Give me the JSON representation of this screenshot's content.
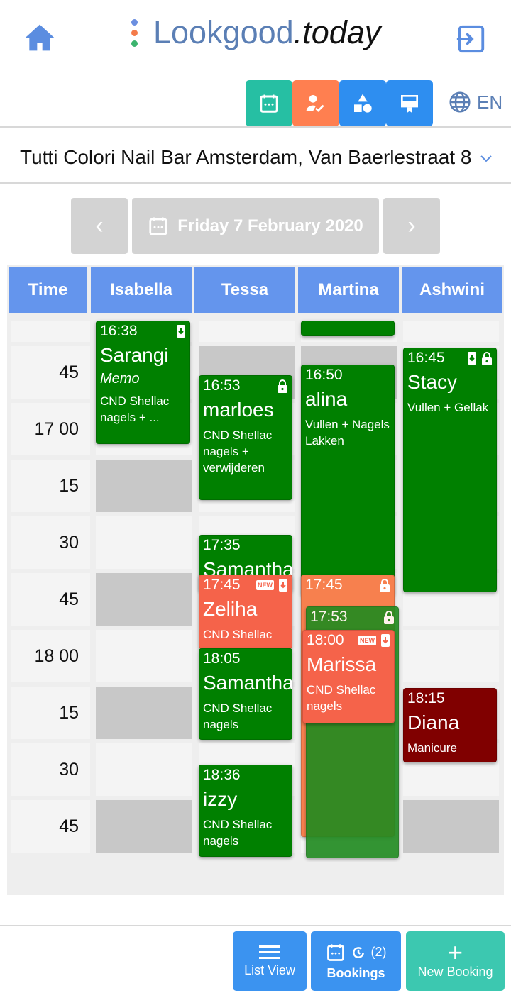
{
  "header": {
    "logo_main": "Lookgood",
    "logo_suffix": ".today",
    "language": "EN"
  },
  "toolbar": {
    "colors": {
      "calendar": "#26bfa3",
      "customers": "#ff7f50",
      "services": "#2e8ef0",
      "vouchers": "#2e8ef0"
    }
  },
  "salon": {
    "selected": "Tutti Colori Nail Bar Amsterdam, Van Baerlestraat 8"
  },
  "date_nav": {
    "date": "Friday 7 February 2020",
    "prev": "‹",
    "next": "›"
  },
  "columns": [
    "Time",
    "Isabella",
    "Tessa",
    "Martina",
    "Ashwini"
  ],
  "time_labels": [
    "45",
    "17 00",
    "15",
    "30",
    "45",
    "18 00",
    "15",
    "30",
    "45"
  ],
  "events": [
    {
      "staff": "Isabella",
      "time": "16:38",
      "name": "Sarangi",
      "memo": "Memo",
      "service": "CND Shellac nagels + ...",
      "color": "#008000",
      "icons": [
        "download"
      ]
    },
    {
      "staff": "Martina",
      "time": "",
      "name": "",
      "service": "",
      "color": "#008000",
      "icons": []
    },
    {
      "staff": "Tessa",
      "time": "16:53",
      "name": "marloes",
      "service": "CND Shellac nagels + verwijderen",
      "color": "#008000",
      "icons": [
        "lock"
      ]
    },
    {
      "staff": "Martina",
      "time": "16:50",
      "name": "alina",
      "service": "Vullen + Nagels Lakken",
      "color": "#008000",
      "icons": []
    },
    {
      "staff": "Ashwini",
      "time": "16:45",
      "name": "Stacy",
      "service": "Vullen + Gellak",
      "color": "#008000",
      "icons": [
        "download",
        "lock"
      ]
    },
    {
      "staff": "Tessa",
      "time": "17:35",
      "name": "Samantha",
      "service": "",
      "color": "#008000",
      "icons": []
    },
    {
      "staff": "Tessa",
      "time": "17:45",
      "name": "Zeliha",
      "service": "CND Shellac",
      "color": "#f5634a",
      "icons": [
        "new",
        "download"
      ]
    },
    {
      "staff": "Tessa",
      "time": "18:05",
      "name": "Samantha",
      "service": "CND Shellac nagels",
      "color": "#008000",
      "icons": []
    },
    {
      "staff": "Tessa",
      "time": "18:36",
      "name": "izzy",
      "service": "CND Shellac nagels",
      "color": "#008000",
      "icons": []
    },
    {
      "staff": "Martina",
      "time": "17:45",
      "name": "",
      "service": "",
      "color": "#f7804e",
      "icons": [
        "lock"
      ]
    },
    {
      "staff": "Martina",
      "time": "17:53",
      "name": "",
      "service": "",
      "color": "#1f8a1f",
      "icons": [
        "lock"
      ]
    },
    {
      "staff": "Martina",
      "time": "18:00",
      "name": "Marissa",
      "service": "CND Shellac nagels",
      "color": "#f5634a",
      "icons": [
        "new",
        "download"
      ]
    },
    {
      "staff": "Ashwini",
      "time": "18:15",
      "name": "Diana",
      "service": "Manicure",
      "color": "#800000",
      "icons": []
    }
  ],
  "bottom": {
    "list_view": "List View",
    "bookings": "Bookings",
    "bookings_count": "(2)",
    "new_booking": "New Booking"
  }
}
